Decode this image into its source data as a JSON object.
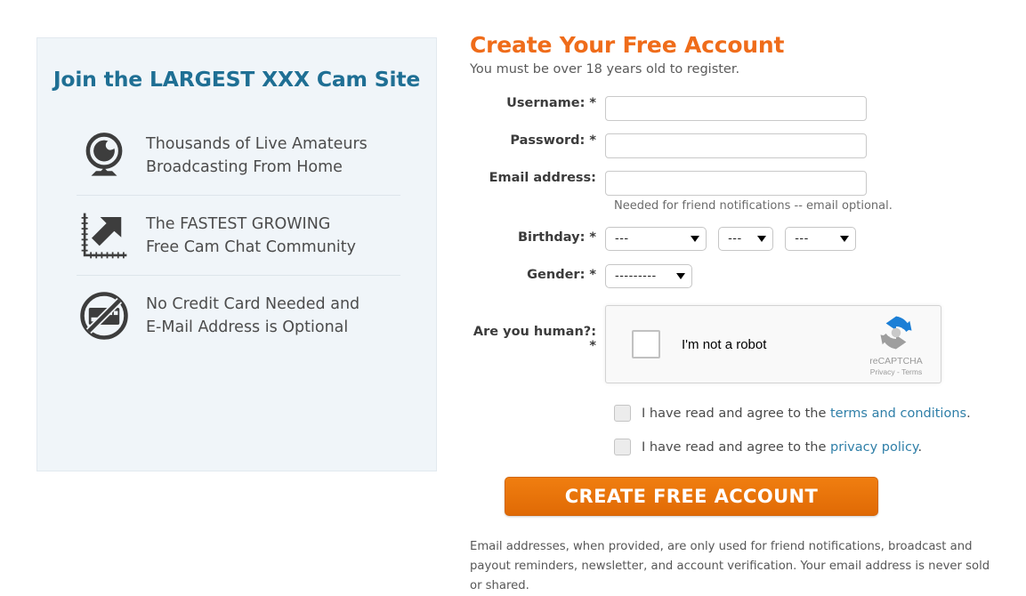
{
  "promo": {
    "title": "Join the LARGEST XXX Cam Site",
    "accent_color": "#1f6f94",
    "features": [
      {
        "icon": "webcam-icon",
        "line1": "Thousands of Live Amateurs",
        "line2": "Broadcasting From Home"
      },
      {
        "icon": "growth-chart-icon",
        "line1": "The FASTEST GROWING",
        "line2": "Free Cam Chat Community"
      },
      {
        "icon": "no-credit-card-icon",
        "line1": "No Credit Card Needed and",
        "line2": "E-Mail Address is Optional"
      }
    ]
  },
  "form": {
    "title": "Create Your Free Account",
    "title_color": "#ef6c1a",
    "subtitle": "You must be over 18 years old to register.",
    "username": {
      "label": "Username: *",
      "value": "",
      "placeholder": ""
    },
    "password": {
      "label": "Password: *",
      "value": "",
      "placeholder": ""
    },
    "email": {
      "label": "Email address:",
      "value": "",
      "placeholder": "",
      "help": "Needed for friend notifications -- email optional."
    },
    "birthday": {
      "label": "Birthday: *",
      "year": {
        "value": "---"
      },
      "month": {
        "value": "---"
      },
      "day": {
        "value": "---"
      }
    },
    "gender": {
      "label": "Gender: *",
      "value": "---------"
    },
    "human": {
      "label": "Are you human?: *"
    },
    "recaptcha": {
      "checkbox_label": "I'm not a robot",
      "brand": "reCAPTCHA",
      "legal": "Privacy - Terms"
    },
    "consent": [
      {
        "prefix": "I have read and agree to the ",
        "link": "terms and conditions",
        "suffix": "."
      },
      {
        "prefix": "I have read and agree to the ",
        "link": "privacy policy",
        "suffix": "."
      }
    ],
    "submit_label": "CREATE FREE ACCOUNT",
    "submit_color": "#e87209",
    "legal_note": "Email addresses, when provided, are only used for friend notifications, broadcast and payout reminders, newsletter, and account verification. Your email address is never sold or shared."
  }
}
